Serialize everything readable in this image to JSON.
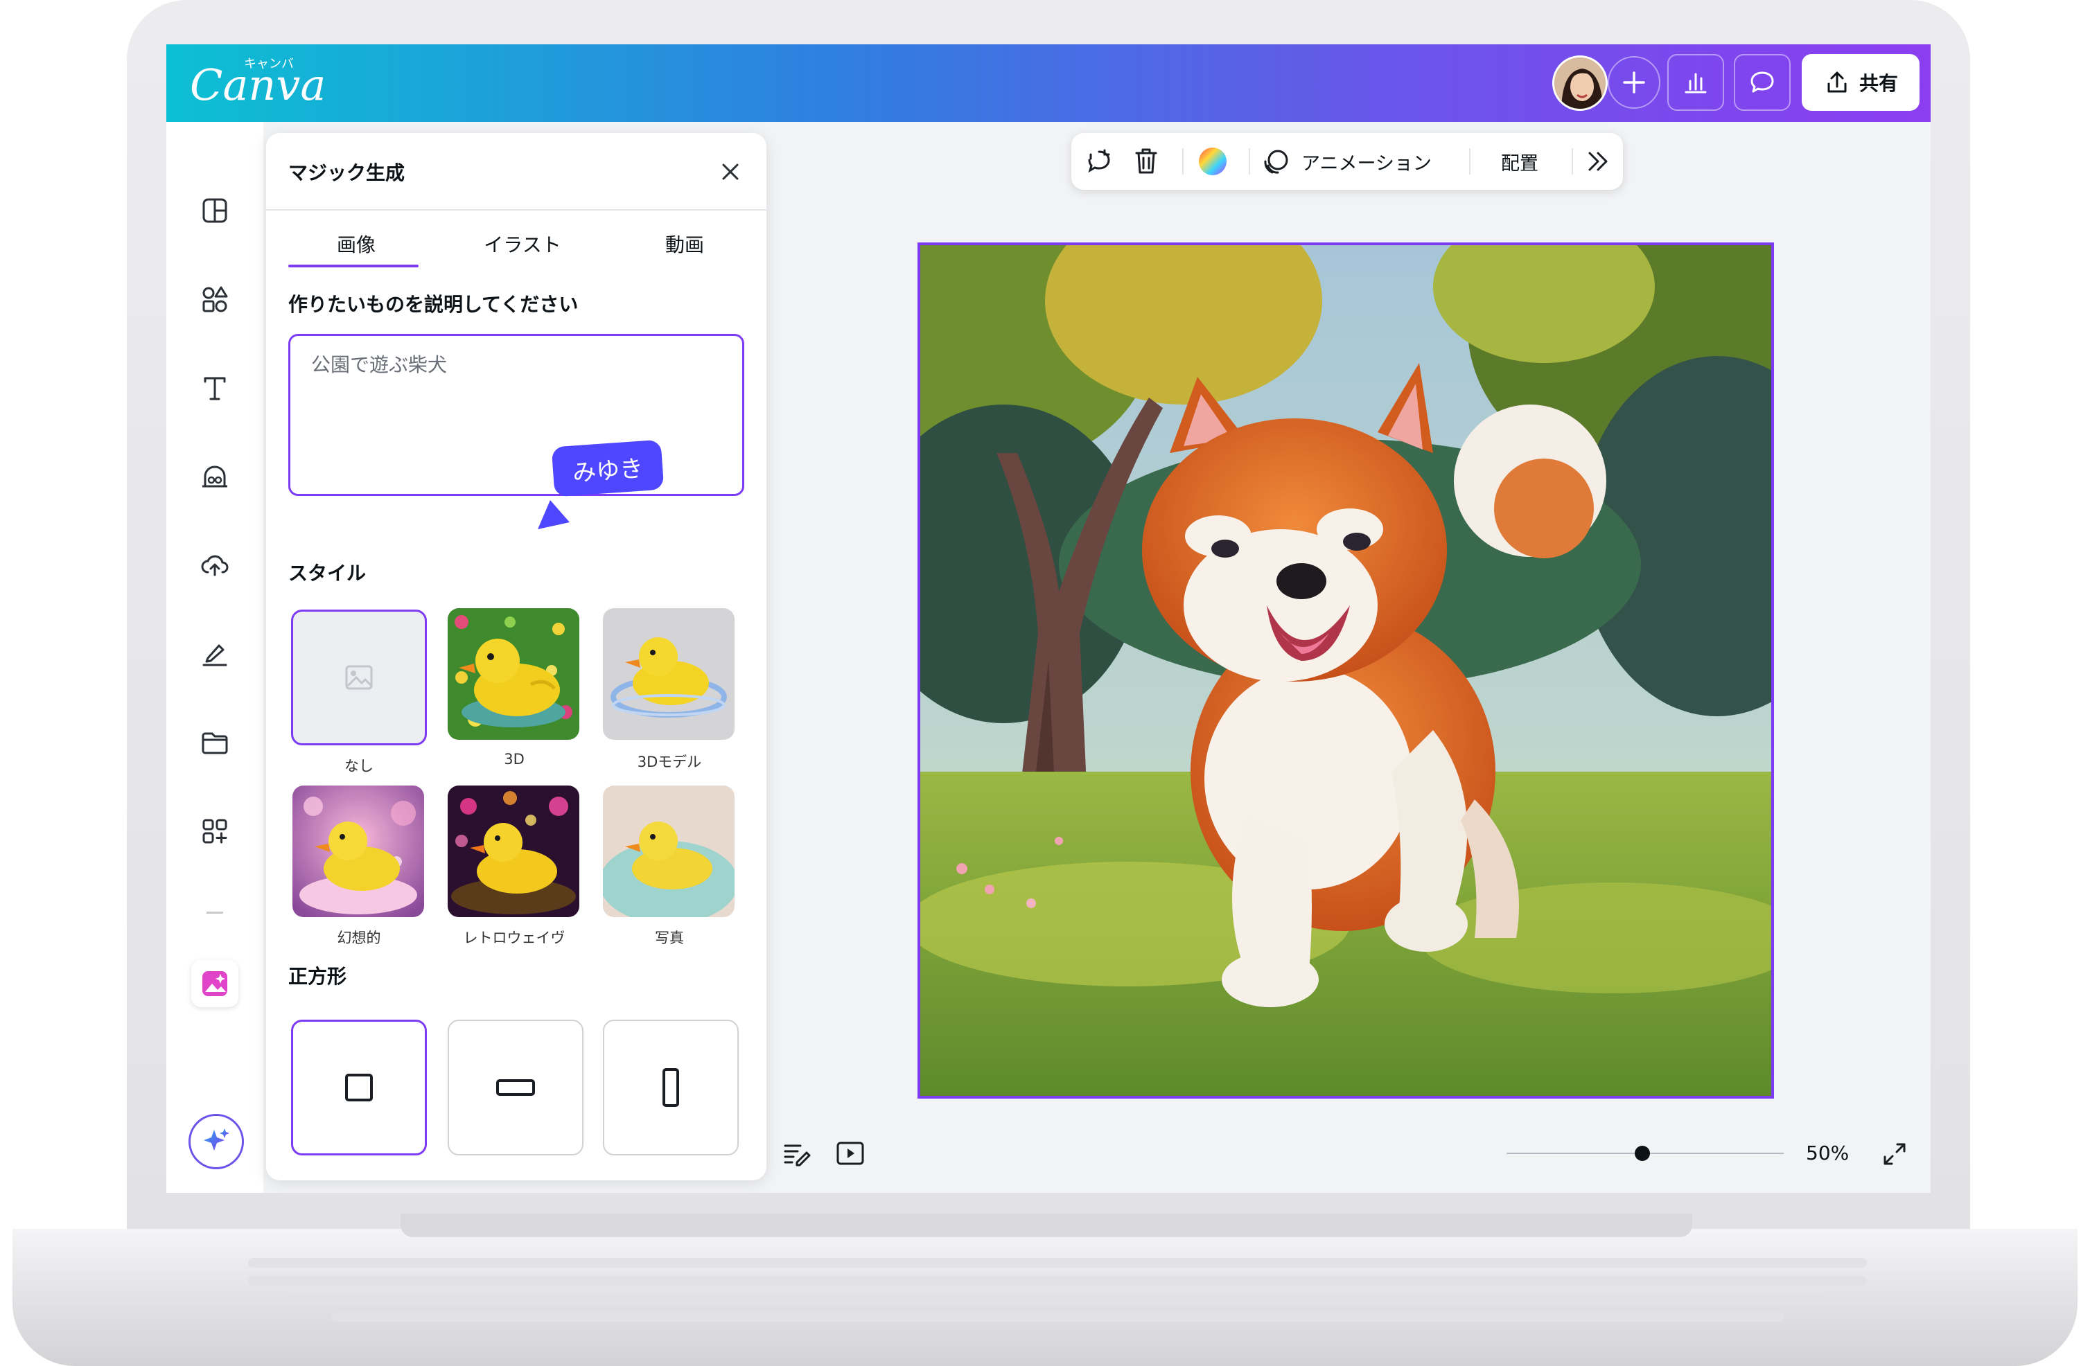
{
  "app": {
    "logo": "Canva",
    "logo_kana": "キャンバ"
  },
  "header": {
    "add_icon": "plus-icon",
    "insights_icon": "bar-chart-icon",
    "comment_icon": "comment-icon",
    "share_label": "共有"
  },
  "sidebar": {
    "items": [
      {
        "name": "design",
        "icon": "layout-icon"
      },
      {
        "name": "elements",
        "icon": "shapes-icon"
      },
      {
        "name": "text",
        "icon": "text-icon"
      },
      {
        "name": "brand",
        "icon": "brand-icon"
      },
      {
        "name": "uploads",
        "icon": "cloud-upload-icon"
      },
      {
        "name": "draw",
        "icon": "pen-icon"
      },
      {
        "name": "projects",
        "icon": "folder-icon"
      },
      {
        "name": "apps",
        "icon": "apps-icon"
      },
      {
        "name": "magic-media",
        "icon": "magic-image-icon",
        "active": true
      }
    ]
  },
  "panel": {
    "title": "マジック生成",
    "tabs": [
      {
        "label": "画像",
        "active": true
      },
      {
        "label": "イラスト",
        "active": false
      },
      {
        "label": "動画",
        "active": false
      }
    ],
    "prompt_heading": "作りたいものを説明してください",
    "prompt_value": "公園で遊ぶ柴犬",
    "collaborator_name": "みゆき",
    "style_heading": "スタイル",
    "styles": [
      {
        "label": "なし",
        "selected": true
      },
      {
        "label": "3D",
        "selected": false
      },
      {
        "label": "3Dモデル",
        "selected": false
      },
      {
        "label": "幻想的",
        "selected": false
      },
      {
        "label": "レトロウェイヴ",
        "selected": false
      },
      {
        "label": "写真",
        "selected": false
      }
    ],
    "ratio_heading": "正方形",
    "ratios": [
      {
        "name": "square",
        "selected": true
      },
      {
        "name": "landscape",
        "selected": false
      },
      {
        "name": "portrait",
        "selected": false
      }
    ]
  },
  "context_toolbar": {
    "animation_label": "アニメーション",
    "position_label": "配置"
  },
  "footer": {
    "zoom_label": "50%",
    "zoom_fraction": 0.49
  },
  "colors": {
    "accent": "#7d3cf4",
    "collaborator": "#4f46ff",
    "header_start": "#0cc0d3",
    "header_end": "#8b3df0"
  }
}
